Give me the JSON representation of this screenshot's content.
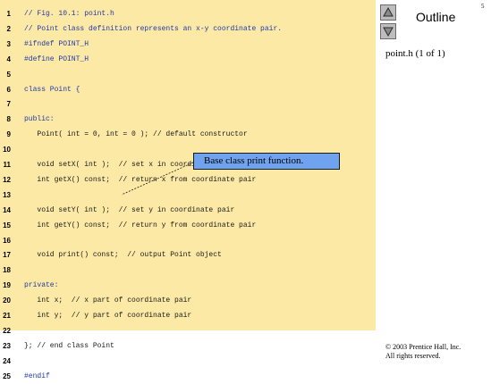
{
  "slide": {
    "number": "5"
  },
  "outline": {
    "title": "Outline",
    "file_caption": "point.h (1 of 1)"
  },
  "callout": {
    "text": "Base class print function."
  },
  "copyright": {
    "line1": "© 2003 Prentice Hall, Inc.",
    "line2": "All rights reserved."
  },
  "icons": {
    "up": "triangle-up-icon",
    "down": "triangle-down-icon"
  },
  "colors": {
    "code_background": "#fce9a6",
    "code_blue": "#1f3aa6",
    "callout_fill": "#6fa3ef"
  },
  "code": {
    "lines": [
      {
        "num": "1",
        "text": "// Fig. 10.1: point.h"
      },
      {
        "num": "2",
        "text": "// Point class definition represents an x-y coordinate pair."
      },
      {
        "num": "3",
        "text": "#ifndef POINT_H"
      },
      {
        "num": "4",
        "text": "#define POINT_H"
      },
      {
        "num": "5",
        "text": ""
      },
      {
        "num": "6",
        "text": "class Point {"
      },
      {
        "num": "7",
        "text": ""
      },
      {
        "num": "8",
        "text": "public:"
      },
      {
        "num": "9",
        "text": "   Point( int = 0, int = 0 ); // default constructor"
      },
      {
        "num": "10",
        "text": ""
      },
      {
        "num": "11",
        "text": "   void setX( int );  // set x in coordinate pair"
      },
      {
        "num": "12",
        "text": "   int getX() const;  // return x from coordinate pair"
      },
      {
        "num": "13",
        "text": ""
      },
      {
        "num": "14",
        "text": "   void setY( int );  // set y in coordinate pair"
      },
      {
        "num": "15",
        "text": "   int getY() const;  // return y from coordinate pair"
      },
      {
        "num": "16",
        "text": ""
      },
      {
        "num": "17",
        "text": "   void print() const;  // output Point object"
      },
      {
        "num": "18",
        "text": ""
      },
      {
        "num": "19",
        "text": "private:"
      },
      {
        "num": "20",
        "text": "   int x;  // x part of coordinate pair"
      },
      {
        "num": "21",
        "text": "   int y;  // y part of coordinate pair"
      },
      {
        "num": "22",
        "text": ""
      },
      {
        "num": "23",
        "text": "}; // end class Point"
      },
      {
        "num": "24",
        "text": ""
      },
      {
        "num": "25",
        "text": "#endif"
      }
    ]
  }
}
